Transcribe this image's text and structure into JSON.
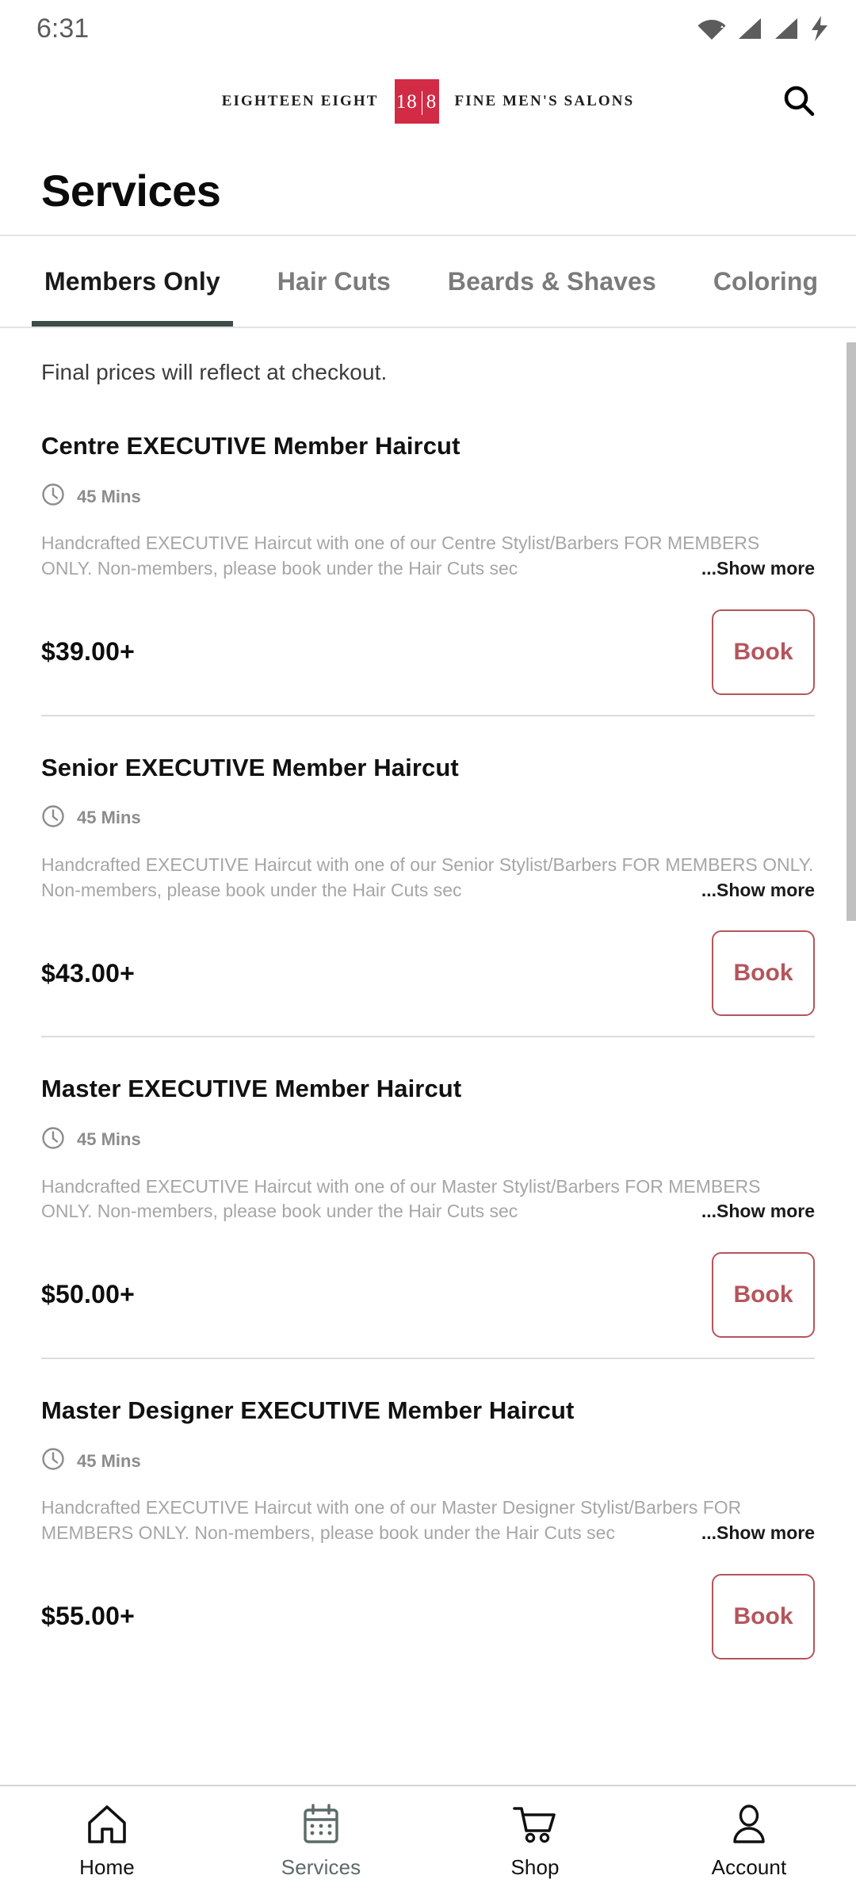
{
  "status_bar": {
    "time": "6:31",
    "icons": [
      "wifi-icon",
      "signal-icon",
      "signal-icon",
      "battery-charging-icon"
    ]
  },
  "header": {
    "logo": {
      "left_text": "EIGHTEEN EIGHT",
      "mark_left": "18",
      "mark_right": "8",
      "right_text": "FINE MEN'S SALONS",
      "mark_color": "#D12B46"
    },
    "search_icon": "search-icon"
  },
  "page": {
    "title": "Services"
  },
  "tabs": [
    {
      "label": "Members Only",
      "active": true
    },
    {
      "label": "Hair Cuts",
      "active": false
    },
    {
      "label": "Beards & Shaves",
      "active": false
    },
    {
      "label": "Coloring",
      "active": false
    }
  ],
  "notice": "Final prices will reflect at checkout.",
  "services": [
    {
      "title": "Centre EXECUTIVE Member Haircut",
      "duration_icon": "clock-icon",
      "duration": "45 Mins",
      "description": "Handcrafted EXECUTIVE Haircut with one of our Centre Stylist/Barbers FOR MEMBERS ONLY.  Non-members, please book under the Hair Cuts sec",
      "show_more_label": "Show more",
      "price": "$39.00+",
      "book_label": "Book"
    },
    {
      "title": "Senior EXECUTIVE Member Haircut",
      "duration_icon": "clock-icon",
      "duration": "45 Mins",
      "description": "Handcrafted EXECUTIVE Haircut with one of our Senior Stylist/Barbers FOR MEMBERS ONLY.  Non-members, please book under the Hair Cuts sec",
      "show_more_label": "Show more",
      "price": "$43.00+",
      "book_label": "Book"
    },
    {
      "title": "Master EXECUTIVE Member Haircut",
      "duration_icon": "clock-icon",
      "duration": "45 Mins",
      "description": "Handcrafted EXECUTIVE Haircut with one of our Master Stylist/Barbers FOR MEMBERS ONLY.  Non-members, please book under the Hair Cuts sec",
      "show_more_label": "Show more",
      "price": "$50.00+",
      "book_label": "Book"
    },
    {
      "title": "Master Designer EXECUTIVE Member Haircut",
      "duration_icon": "clock-icon",
      "duration": "45 Mins",
      "description": "Handcrafted EXECUTIVE Haircut with one of our Master Designer Stylist/Barbers FOR MEMBERS ONLY.  Non-members, please book under the Hair Cuts sec",
      "show_more_label": "Show more",
      "price": "$55.00+",
      "book_label": "Book"
    }
  ],
  "bottom_nav": [
    {
      "label": "Home",
      "icon": "home-icon",
      "active": false
    },
    {
      "label": "Services",
      "icon": "calendar-icon",
      "active": true
    },
    {
      "label": "Shop",
      "icon": "cart-icon",
      "active": false
    },
    {
      "label": "Account",
      "icon": "person-icon",
      "active": false
    }
  ],
  "colors": {
    "brand_red": "#D12B46",
    "book_accent": "#b5555c",
    "tab_active_underline": "#3d4c49",
    "nav_active": "#5c6b68"
  }
}
